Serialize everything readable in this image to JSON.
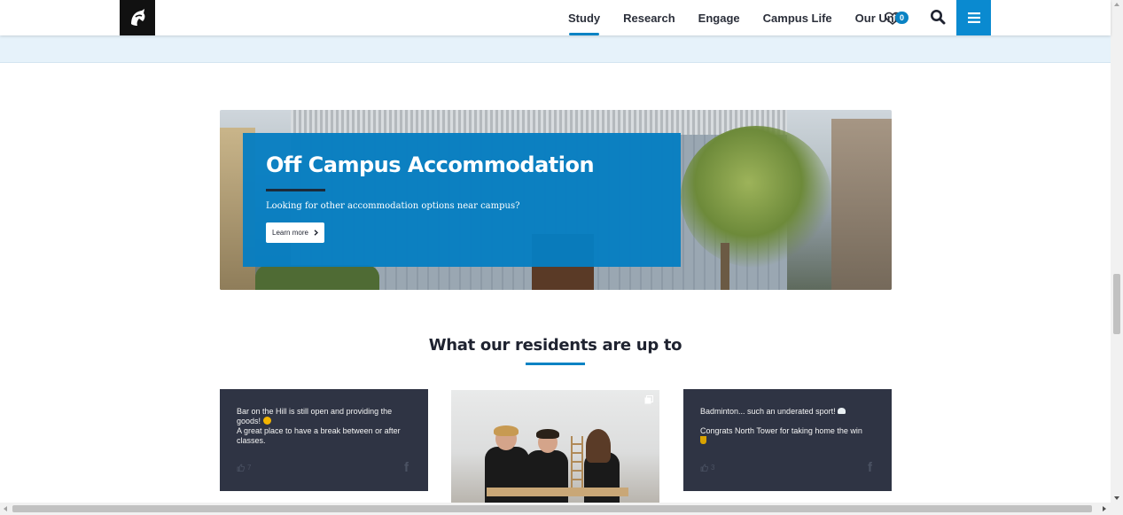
{
  "header": {
    "logo_icon": "stylized-horse-logo-icon",
    "nav": [
      {
        "label": "Study",
        "active": true
      },
      {
        "label": "Research",
        "active": false
      },
      {
        "label": "Engage",
        "active": false
      },
      {
        "label": "Campus Life",
        "active": false
      },
      {
        "label": "Our Uni",
        "active": false
      }
    ],
    "favourites_count": "0",
    "favourites_icon": "heart-icon",
    "search_icon": "search-icon",
    "menu_icon": "hamburger-menu-icon"
  },
  "hero": {
    "title": "Off Campus Accommodation",
    "subtitle": "Looking for other accommodation options near campus?",
    "button_label": "Learn more",
    "button_icon": "chevron-right-icon"
  },
  "residents": {
    "title": "What our residents are up to",
    "cards": [
      {
        "type": "text",
        "lines": [
          "Bar on the Hill is still open and providing the goods!",
          "A great place to have a break between or after classes."
        ],
        "likes": "7",
        "network_icon": "facebook-icon"
      },
      {
        "type": "photo",
        "overlay_icon": "multiple-images-icon"
      },
      {
        "type": "text",
        "lines": [
          "Badminton... such an underated sport!",
          "Congrats North Tower for taking home the win"
        ],
        "likes": "3",
        "network_icon": "facebook-icon"
      }
    ]
  },
  "colors": {
    "accent": "#0a83c4",
    "card_bg": "#2f3444",
    "band": "#e6f2fa"
  }
}
